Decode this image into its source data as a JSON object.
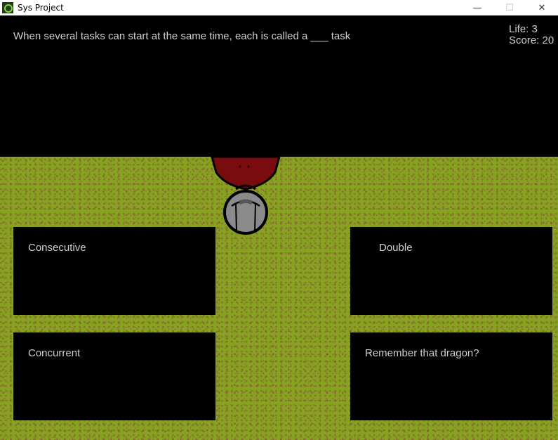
{
  "window": {
    "title": "Sys Project",
    "controls": {
      "minimize": "—",
      "maximize": "☐",
      "close": "✕"
    }
  },
  "game": {
    "question": "When several tasks can start at the same time, each is called a ___ task",
    "hud": {
      "life_text": "Life: 3",
      "score_text": "Score: 20"
    },
    "answers": [
      {
        "label": "Consecutive"
      },
      {
        "label": "Double"
      },
      {
        "label": "Concurrent"
      },
      {
        "label": "Remember that dragon?"
      }
    ]
  },
  "colors": {
    "grass": "#86a31f",
    "dirt": "#8c503c",
    "panel": "#000000",
    "text": "#cfcfcf",
    "player_cape": "#7a0c10",
    "player_helmet": "#8a8a8a"
  }
}
